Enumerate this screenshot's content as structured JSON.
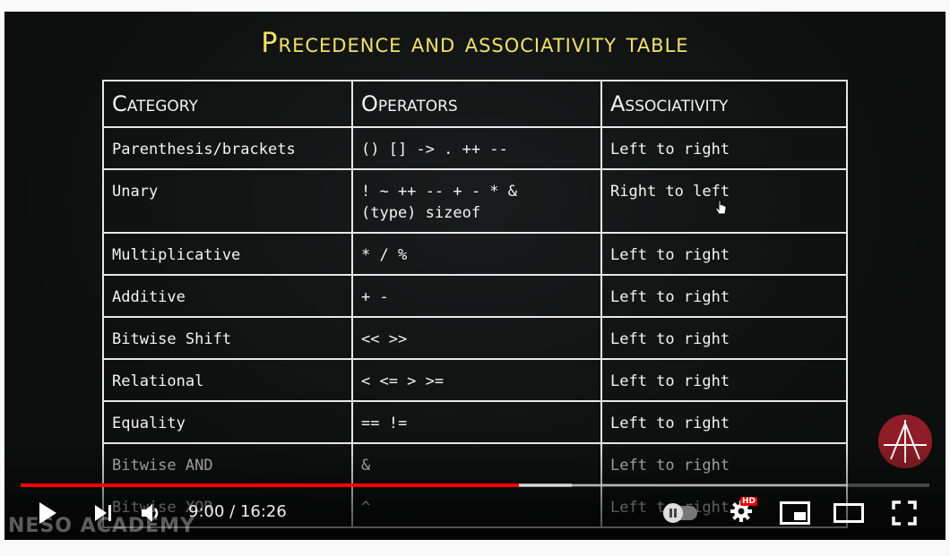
{
  "slide": {
    "title": "Precedence and associativity table",
    "headers": [
      "Category",
      "Operators",
      "Associativity"
    ],
    "rows": [
      {
        "category": "Parenthesis/brackets",
        "operators": "() [] -> . ++ --",
        "assoc": "Left to right"
      },
      {
        "category": "Unary",
        "operators": "! ~ ++ -- + - * &",
        "operators2": "(type) sizeof",
        "assoc": "Right to left"
      },
      {
        "category": "Multiplicative",
        "operators": "* / %",
        "assoc": "Left to right"
      },
      {
        "category": "Additive",
        "operators": "+ -",
        "assoc": "Left to right"
      },
      {
        "category": "Bitwise Shift",
        "operators": "<< >>",
        "assoc": "Left to right"
      },
      {
        "category": "Relational",
        "operators": "< <= > >=",
        "assoc": "Left to right"
      },
      {
        "category": "Equality",
        "operators": "== !=",
        "assoc": "Left to right"
      },
      {
        "category": "Bitwise AND",
        "operators": "&",
        "assoc": "Left to right"
      },
      {
        "category": "Bitwise XOR",
        "operators": "^",
        "assoc": "Left to right"
      }
    ],
    "watermark": "NESO ACADEMY"
  },
  "player": {
    "current_time": "9:00",
    "separator": " / ",
    "duration": "16:26",
    "progress_fraction": 0.548,
    "buffered_fraction": 0.607,
    "hd_badge": "HD",
    "accent_color": "#ff0000"
  },
  "icons": [
    "play-icon",
    "next-icon",
    "volume-icon",
    "autoplay-toggle",
    "settings-icon",
    "miniplayer-icon",
    "theater-icon",
    "fullscreen-icon"
  ]
}
